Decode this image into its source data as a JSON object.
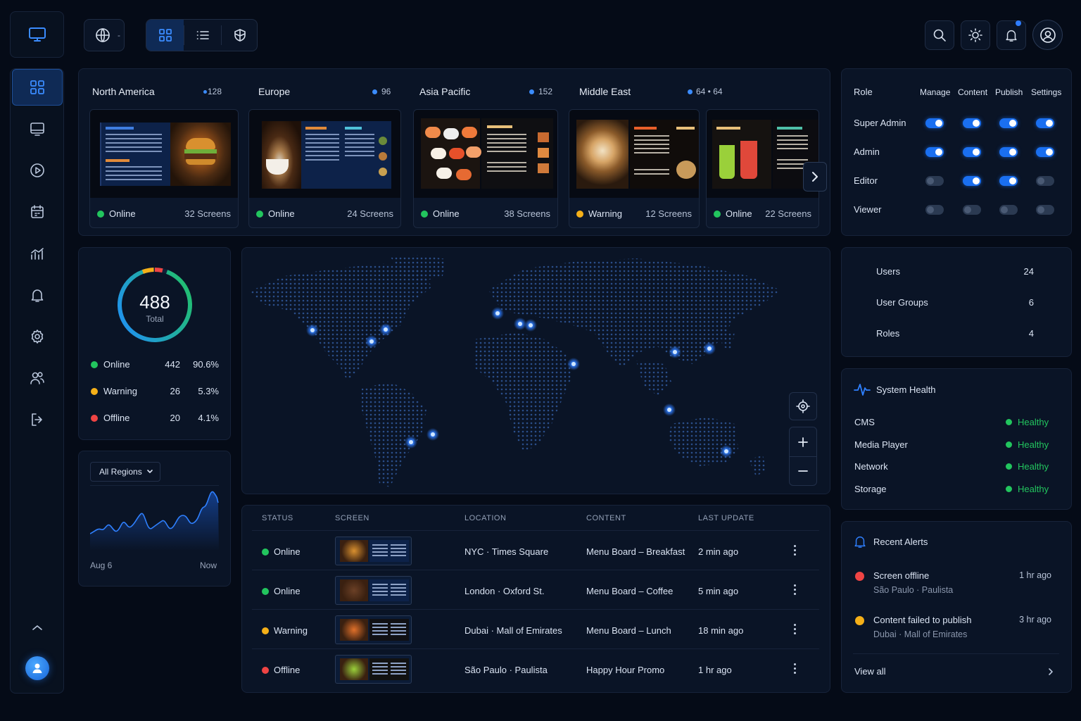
{
  "topbar": {
    "lang_caret": "-"
  },
  "regions": [
    {
      "name": "North America",
      "count": "128",
      "status": "Online",
      "screens": "32 Screens",
      "status_color": "#22c55e"
    },
    {
      "name": "Europe",
      "count": "96",
      "status": "Online",
      "screens": "24 Screens",
      "status_color": "#22c55e"
    },
    {
      "name": "Asia Pacific",
      "count": "152",
      "status": "Online",
      "screens": "38 Screens",
      "status_color": "#22c55e"
    },
    {
      "name": "Middle East",
      "count": "64 • 64",
      "status": "Warning",
      "screens": "12 Screens",
      "status_color": "#f5b018"
    },
    {
      "name": "",
      "count": "",
      "status": "Online",
      "screens": "22 Screens",
      "status_color": "#22c55e"
    }
  ],
  "permissions": {
    "header": [
      "Role",
      "Manage",
      "Content",
      "Publish",
      "Settings"
    ],
    "rows": [
      {
        "role": "Super Admin",
        "toggles": [
          true,
          true,
          true,
          true
        ]
      },
      {
        "role": "Admin",
        "toggles": [
          true,
          true,
          true,
          true
        ]
      },
      {
        "role": "Editor",
        "toggles": [
          false,
          true,
          true,
          false
        ]
      },
      {
        "role": "Viewer",
        "toggles": [
          false,
          false,
          false,
          false
        ]
      }
    ]
  },
  "summary": {
    "total": "488",
    "total_label": "Total",
    "rows": [
      {
        "label": "Online",
        "count": "442",
        "pct": "90.6%",
        "color": "#22c55e"
      },
      {
        "label": "Warning",
        "count": "26",
        "pct": "5.3%",
        "color": "#f5b018"
      },
      {
        "label": "Offline",
        "count": "20",
        "pct": "4.1%",
        "color": "#ef4444"
      }
    ]
  },
  "trend": {
    "filter": "All Regions",
    "x_start": "Aug 6",
    "x_end": "Now"
  },
  "table": {
    "headers": [
      "STATUS",
      "SCREEN",
      "LOCATION",
      "CONTENT",
      "LAST UPDATE"
    ],
    "rows": [
      {
        "status": "Online",
        "color": "#22c55e",
        "location": "NYC · Times Square",
        "content": "Menu Board – Breakfast",
        "updated": "2 min ago"
      },
      {
        "status": "Online",
        "color": "#22c55e",
        "location": "London · Oxford St.",
        "content": "Menu Board – Coffee",
        "updated": "5 min ago"
      },
      {
        "status": "Warning",
        "color": "#f5b018",
        "location": "Dubai · Mall of Emirates",
        "content": "Menu Board – Lunch",
        "updated": "18 min ago"
      },
      {
        "status": "Offline",
        "color": "#ef4444",
        "location": "São Paulo · Paulista",
        "content": "Happy Hour Promo",
        "updated": "1 hr ago"
      }
    ]
  },
  "access": [
    {
      "label": "Users",
      "count": "24"
    },
    {
      "label": "User Groups",
      "count": "6"
    },
    {
      "label": "Roles",
      "count": "4"
    }
  ],
  "health": {
    "title": "System Health",
    "rows": [
      {
        "label": "CMS",
        "status": "Healthy"
      },
      {
        "label": "Media Player",
        "status": "Healthy"
      },
      {
        "label": "Network",
        "status": "Healthy"
      },
      {
        "label": "Storage",
        "status": "Healthy"
      }
    ]
  },
  "alerts": {
    "title": "Recent Alerts",
    "items": [
      {
        "title": "Screen offline",
        "sub": "São Paulo · Paulista",
        "time": "1 hr ago",
        "color": "#ef4444"
      },
      {
        "title": "Content failed to publish",
        "sub": "Dubai · Mall of Emirates",
        "time": "3 hr ago",
        "color": "#f5b018"
      }
    ],
    "view_all": "View all"
  }
}
